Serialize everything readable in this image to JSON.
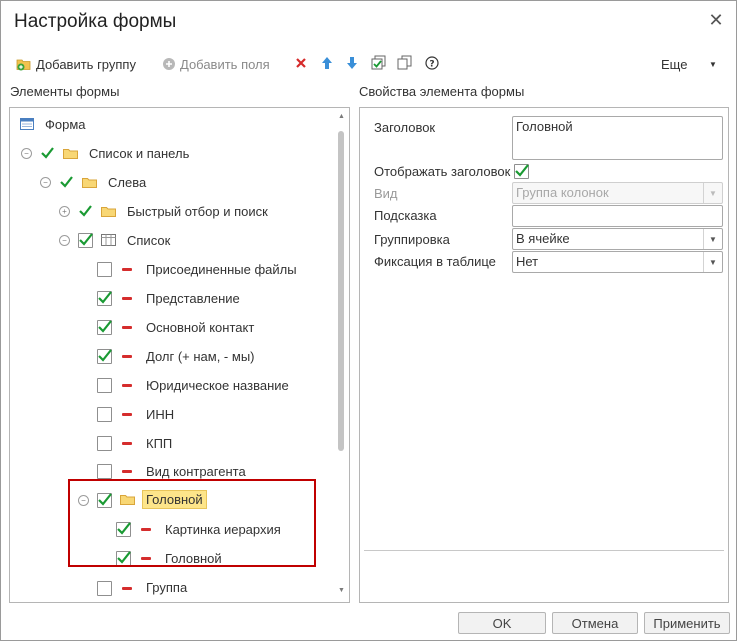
{
  "window": {
    "title": "Настройка формы",
    "close_icon": "close-icon"
  },
  "toolbar": {
    "add_group": "Добавить группу",
    "add_fields": "Добавить поля",
    "more": "Еще",
    "icons": [
      "delete-icon",
      "move-up-icon",
      "move-down-icon",
      "check-all-icon",
      "copy-icon",
      "help-icon"
    ]
  },
  "left_panel": {
    "header": "Элементы формы"
  },
  "right_panel": {
    "header": "Свойства элемента формы"
  },
  "tree": {
    "form": "Форма",
    "list_and_panel": "Список и панель",
    "left": "Слева",
    "quick_filter": "Быстрый отбор и поиск",
    "list": "Список",
    "items": [
      {
        "label": "Присоединенные файлы",
        "checked": false
      },
      {
        "label": "Представление",
        "checked": true
      },
      {
        "label": "Основной контакт",
        "checked": true
      },
      {
        "label": "Долг (+ нам, - мы)",
        "checked": true
      },
      {
        "label": "Юридическое название",
        "checked": false
      },
      {
        "label": "ИНН",
        "checked": false
      },
      {
        "label": "КПП",
        "checked": false
      },
      {
        "label": "Вид контрагента",
        "checked": false
      }
    ],
    "head_group": "Головной",
    "head_children": [
      {
        "label": "Картинка иерархия",
        "checked": true
      },
      {
        "label": "Головной",
        "checked": true
      }
    ],
    "group": "Группа"
  },
  "properties": {
    "title_label": "Заголовок",
    "title_value": "Головной",
    "show_title_label": "Отображать заголовок",
    "show_title_checked": true,
    "kind_label": "Вид",
    "kind_value": "Группа колонок",
    "hint_label": "Подсказка",
    "hint_value": "",
    "grouping_label": "Группировка",
    "grouping_value": "В ячейке",
    "fix_label": "Фиксация в таблице",
    "fix_value": "Нет"
  },
  "footer": {
    "ok": "OK",
    "cancel": "Отмена",
    "apply": "Применить"
  },
  "colors": {
    "check": "#1a9a33",
    "minus": "#d52d2d",
    "folder": "#f2c24f",
    "selection": "#fde58a",
    "highlight_border": "#c00000"
  }
}
